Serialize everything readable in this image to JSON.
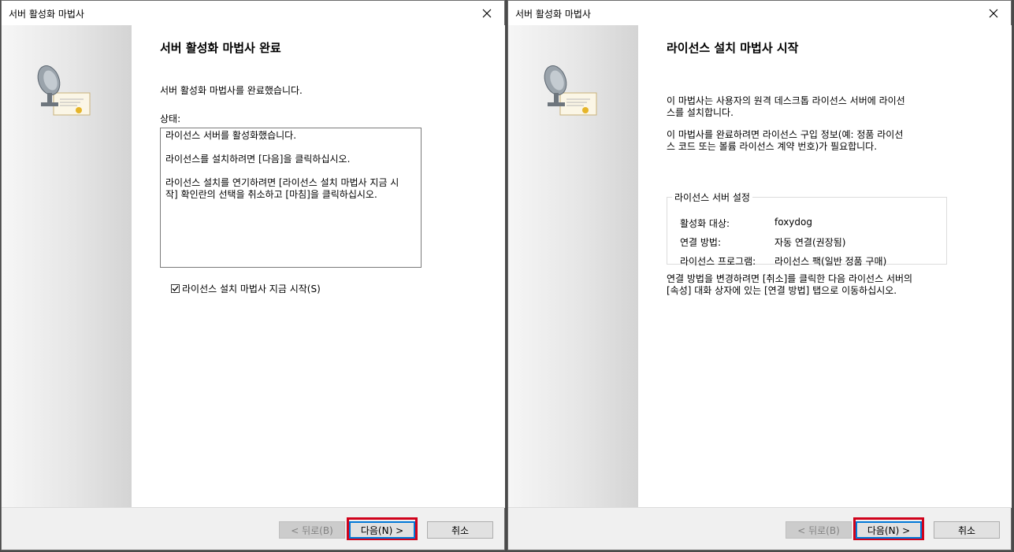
{
  "left": {
    "window_title": "서버 활성화 마법사",
    "heading": "서버 활성화 마법사 완료",
    "intro": "서버 활성화 마법사를 완료했습니다.",
    "status_label": "상태:",
    "status_text": "라이선스 서버를 활성화했습니다.\n\n라이선스를 설치하려면 [다음]을 클릭하십시오.\n\n라이선스 설치를 연기하려면 [라이선스 설치 마법사 지금 시\n작] 확인란의 선택을 취소하고 [마침]을 클릭하십시오.",
    "checkbox_label": "라이선스 설치 마법사 지금 시작(S)",
    "checkbox_checked": true,
    "buttons": {
      "back": "< 뒤로(B)",
      "next": "다음(N) >",
      "cancel": "취소"
    }
  },
  "right": {
    "window_title": "서버 활성화 마법사",
    "heading": "라이선스 설치 마법사 시작",
    "para1": "이 마법사는 사용자의 원격 데스크톱 라이선스 서버에 라이선\n스를 설치합니다.",
    "para2": "이 마법사를 완료하려면 라이선스 구입 정보(예: 정품 라이선\n스 코드 또는 볼륨 라이선스 계약 번호)가 필요합니다.",
    "group_title": "라이선스 서버 설정",
    "settings": [
      {
        "label": "활성화 대상:",
        "value": "foxydog"
      },
      {
        "label": "연결 방법:",
        "value": "자동 연결(권장됨)"
      },
      {
        "label": "라이선스 프로그램:",
        "value": "라이선스 팩(일반 정품 구매)"
      }
    ],
    "note": "연결 방법을 변경하려면 [취소]를 클릭한 다음 라이선스 서버의\n[속성] 대화 상자에 있는 [연결 방법] 탭으로 이동하십시오.",
    "buttons": {
      "back": "< 뒤로(B)",
      "next": "다음(N) >",
      "cancel": "취소"
    }
  },
  "colors": {
    "highlight": "#d0021b",
    "focus": "#0078d7"
  },
  "icons": [
    "close-icon",
    "license-server-icon",
    "checkmark-icon"
  ]
}
